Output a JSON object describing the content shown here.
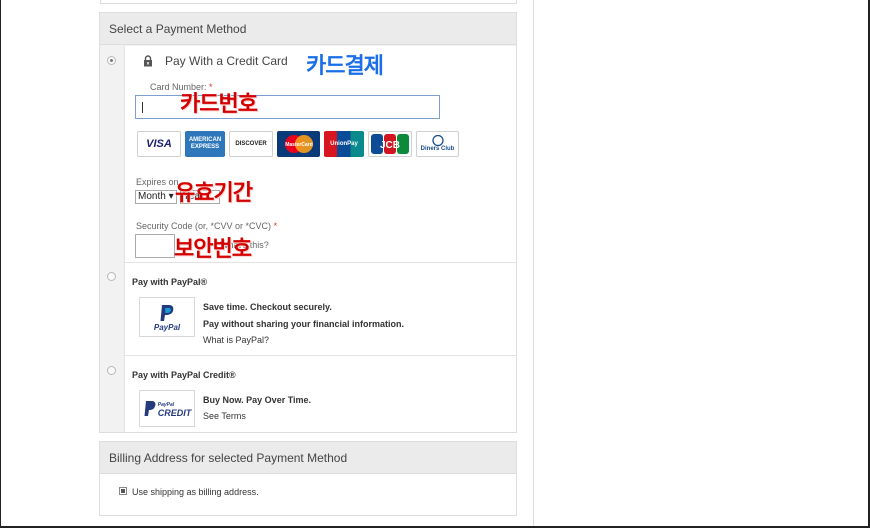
{
  "payment_section": {
    "title": "Select a Payment Method",
    "credit_card": {
      "title": "Pay With a Credit Card",
      "selected": true,
      "card_number_label": "Card Number:",
      "card_number_value": "",
      "required_mark": "*",
      "card_brands": [
        "VISA",
        "AMERICAN EXPRESS",
        "DISCOVER",
        "MasterCard",
        "UnionPay",
        "JCB",
        "Diners Club"
      ],
      "expires_label": "Expires on",
      "month_value": "Month",
      "year_value": "Year",
      "security_label": "Security Code (or, *CVV or *CVC)",
      "whats_this": "What's this?"
    },
    "paypal": {
      "title": "Pay with PayPal®",
      "line1": "Save time. Checkout securely.",
      "line2": "Pay without sharing your financial information.",
      "link": "What is PayPal?",
      "logo_text": "PayPal"
    },
    "paypal_credit": {
      "title": "Pay with PayPal Credit®",
      "line1": "Buy Now. Pay Over Time.",
      "link": "See Terms",
      "logo_top": "PayPal",
      "logo_bottom": "CREDIT"
    }
  },
  "billing_section": {
    "title": "Billing Address for selected Payment Method",
    "checkbox_label": "Use shipping as billing address.",
    "checked": true
  },
  "annotations": {
    "card_payment": "카드결제",
    "card_number": "카드번호",
    "expiry": "유효기간",
    "security_code": "보안번호"
  },
  "colors": {
    "annotation_red": "#d30000",
    "annotation_blue": "#1a6fe8",
    "header_bg": "#ebebeb"
  }
}
